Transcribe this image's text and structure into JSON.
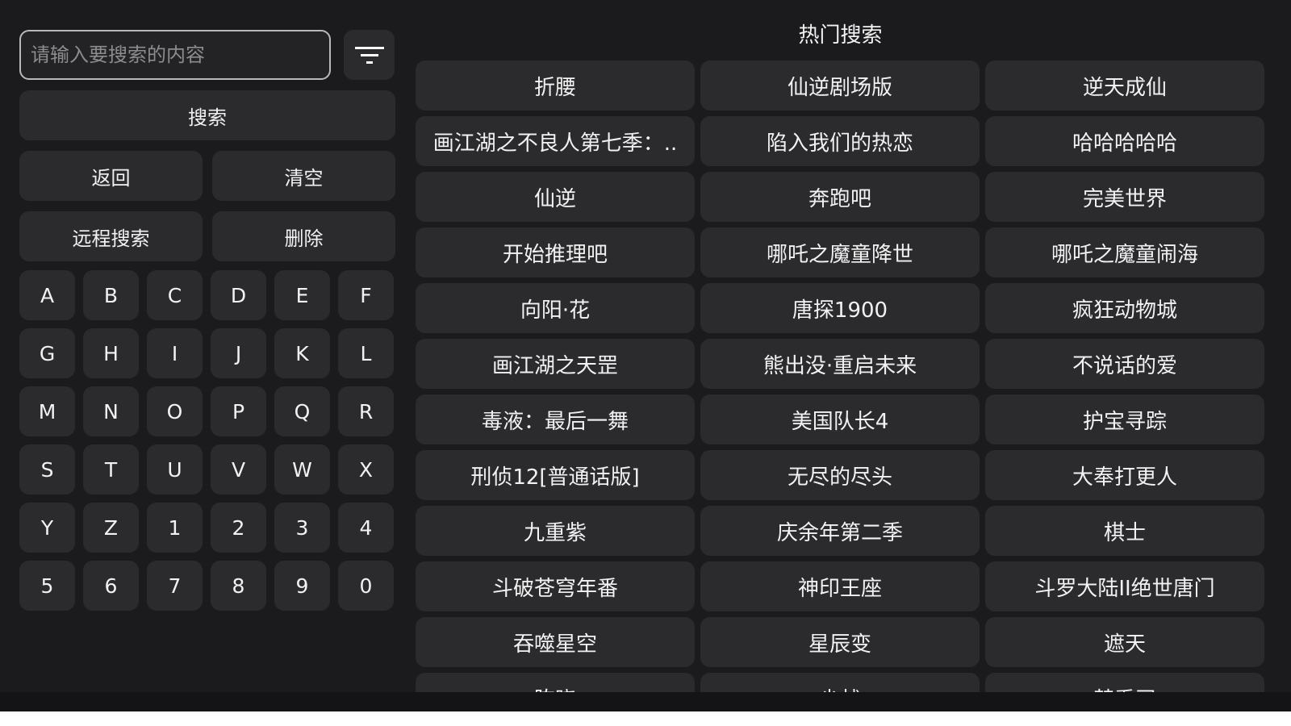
{
  "search": {
    "placeholder": "请输入要搜索的内容",
    "value": "",
    "search_label": "搜索"
  },
  "filter_icon": "filter-icon",
  "actions": {
    "back_label": "返回",
    "clear_label": "清空",
    "remote_search_label": "远程搜索",
    "delete_label": "删除"
  },
  "keyboard": {
    "keys": [
      "A",
      "B",
      "C",
      "D",
      "E",
      "F",
      "G",
      "H",
      "I",
      "J",
      "K",
      "L",
      "M",
      "N",
      "O",
      "P",
      "Q",
      "R",
      "S",
      "T",
      "U",
      "V",
      "W",
      "X",
      "Y",
      "Z",
      "1",
      "2",
      "3",
      "4",
      "5",
      "6",
      "7",
      "8",
      "9",
      "0"
    ]
  },
  "hot": {
    "title": "热门搜索",
    "items": [
      "折腰",
      "仙逆剧场版",
      "逆天成仙",
      "画江湖之不良人第七季：..",
      "陷入我们的热恋",
      "哈哈哈哈哈",
      "仙逆",
      "奔跑吧",
      "完美世界",
      "开始推理吧",
      "哪吒之魔童降世",
      "哪吒之魔童闹海",
      "向阳·花",
      "唐探1900",
      "疯狂动物城",
      "画江湖之天罡",
      "熊出没·重启未来",
      "不说话的爱",
      "毒液：最后一舞",
      "美国队长4",
      "护宝寻踪",
      "刑侦12[普通话版]",
      "无尽的尽头",
      "大奉打更人",
      "九重紫",
      "庆余年第二季",
      "棋士",
      "斗破苍穹年番",
      "神印王座",
      "斗罗大陆II绝世唐门",
      "吞噬星空",
      "星辰变",
      "遮天",
      "陈晓",
      "尘战",
      "楚乔司"
    ]
  },
  "colors": {
    "background": "#1b1b1d",
    "button": "#2b2b2e",
    "input_border": "#b9b9bd",
    "text": "#f2f2f2"
  }
}
